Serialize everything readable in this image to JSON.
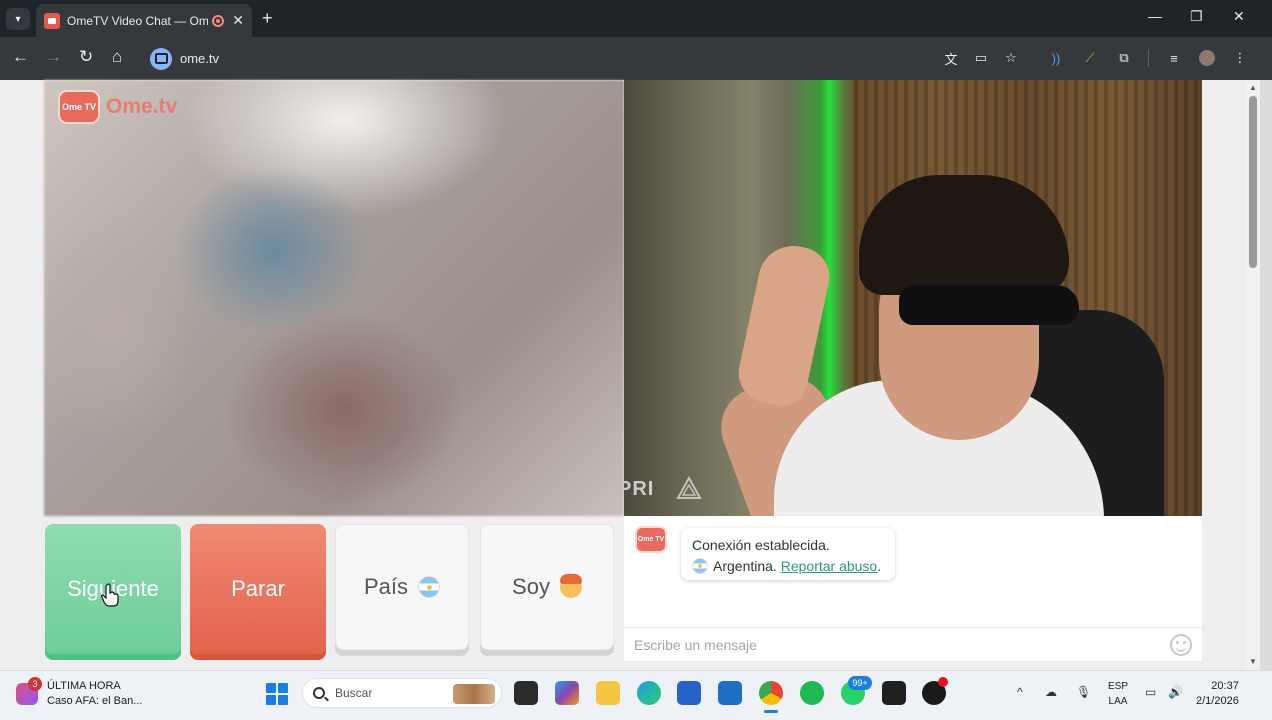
{
  "browser": {
    "tab_title": "OmeTV Video Chat — Ome",
    "tab_close": "✕",
    "new_tab": "+",
    "url": "ome.tv",
    "window_controls": {
      "minimize": "—",
      "maximize": "❐",
      "close": "✕"
    }
  },
  "site": {
    "logo_badge": "Ome TV",
    "logo_text": "Ome.tv",
    "watermark": "PRI"
  },
  "controls": {
    "next_label": "Siguiente",
    "stop_label": "Parar",
    "country_label": "País",
    "gender_label": "Soy"
  },
  "chat": {
    "avatar_text": "Ome TV",
    "message_line1": "Conexión establecida.",
    "country": "Argentina.",
    "report_link": "Reportar abuso",
    "report_suffix": ".",
    "input_placeholder": "Escribe un mensaje"
  },
  "taskbar": {
    "news_badge": "3",
    "news_title": "ÚLTIMA HORA",
    "news_subtitle": "Caso AFA: el Ban...",
    "search_placeholder": "Buscar",
    "whatsapp_badge": "99+",
    "language_line1": "ESP",
    "language_line2": "LAA",
    "time": "20:37",
    "date": "2/1/2026",
    "tray_chevron": "^"
  },
  "colors": {
    "next_green": "#6dcd98",
    "stop_red": "#e4624c",
    "brand_red": "#ea6b5e",
    "link_green": "#2d9a7a"
  }
}
